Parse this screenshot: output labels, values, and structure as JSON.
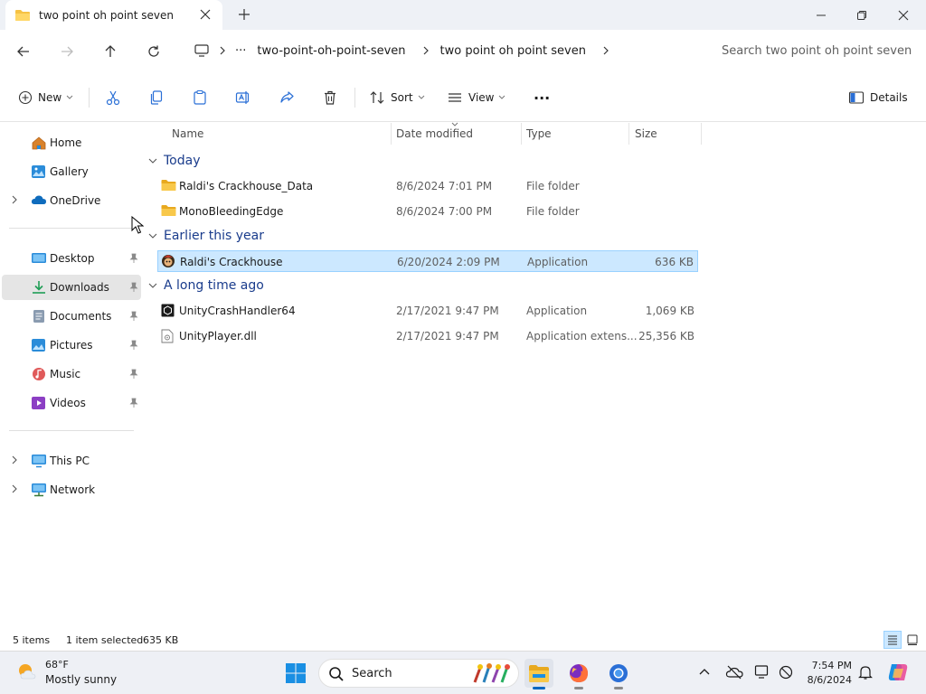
{
  "window": {
    "tab_title": "two point oh point seven"
  },
  "address": {
    "ellipsis": "···",
    "crumbs": [
      "two-point-oh-point-seven",
      "two point oh point seven"
    ],
    "search_placeholder": "Search two point oh point seven"
  },
  "toolbar": {
    "new_label": "New",
    "sort_label": "Sort",
    "view_label": "View",
    "more_label": "···",
    "details_label": "Details"
  },
  "sidebar": {
    "items": [
      {
        "label": "Home",
        "icon": "home-icon"
      },
      {
        "label": "Gallery",
        "icon": "gallery-icon"
      },
      {
        "label": "OneDrive",
        "icon": "onedrive-icon"
      },
      {
        "label": "Desktop",
        "icon": "desktop-icon",
        "pinned": true
      },
      {
        "label": "Downloads",
        "icon": "downloads-icon",
        "pinned": true,
        "selected": true
      },
      {
        "label": "Documents",
        "icon": "documents-icon",
        "pinned": true
      },
      {
        "label": "Pictures",
        "icon": "pictures-icon",
        "pinned": true
      },
      {
        "label": "Music",
        "icon": "music-icon",
        "pinned": true
      },
      {
        "label": "Videos",
        "icon": "videos-icon",
        "pinned": true
      },
      {
        "label": "This PC",
        "icon": "this-pc-icon"
      },
      {
        "label": "Network",
        "icon": "network-icon"
      }
    ]
  },
  "columns": {
    "name": "Name",
    "date": "Date modified",
    "type": "Type",
    "size": "Size"
  },
  "groups": [
    {
      "title": "Today",
      "files": [
        {
          "name": "Raldi's Crackhouse_Data",
          "date": "8/6/2024 7:01 PM",
          "type": "File folder",
          "size": "",
          "icon": "folder-icon"
        },
        {
          "name": "MonoBleedingEdge",
          "date": "8/6/2024 7:00 PM",
          "type": "File folder",
          "size": "",
          "icon": "folder-icon"
        }
      ]
    },
    {
      "title": "Earlier this year",
      "files": [
        {
          "name": "Raldi's Crackhouse",
          "date": "6/20/2024 2:09 PM",
          "type": "Application",
          "size": "636 KB",
          "icon": "game-app-icon",
          "selected": true
        }
      ]
    },
    {
      "title": "A long time ago",
      "files": [
        {
          "name": "UnityCrashHandler64",
          "date": "2/17/2021 9:47 PM",
          "type": "Application",
          "size": "1,069 KB",
          "icon": "unity-app-icon"
        },
        {
          "name": "UnityPlayer.dll",
          "date": "2/17/2021 9:47 PM",
          "type": "Application extens...",
          "size": "25,356 KB",
          "icon": "dll-file-icon"
        }
      ]
    }
  ],
  "status": {
    "item_count": "5 items",
    "selection": "1 item selected",
    "selection_size": "635 KB"
  },
  "taskbar": {
    "weather_temp": "68°F",
    "weather_desc": "Mostly sunny",
    "search_label": "Search",
    "time": "7:54 PM",
    "date": "8/6/2024"
  },
  "colors": {
    "accent": "#0067c0",
    "selection_bg": "#cce8ff",
    "selection_border": "#99d1ff",
    "folder": "#f6c244",
    "group_title": "#1a3c8c"
  }
}
